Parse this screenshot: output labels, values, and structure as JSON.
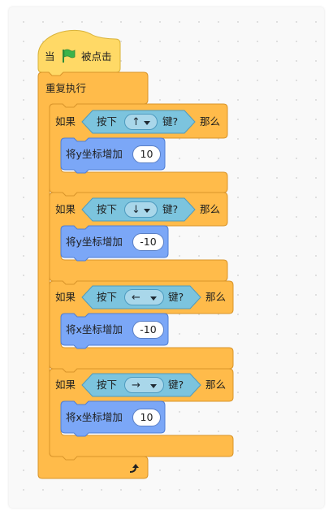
{
  "script": {
    "hat": {
      "prefix": "当",
      "suffix": "被点击",
      "icon": "green-flag-icon"
    },
    "forever": {
      "label": "重复执行",
      "icon": "loop-arrow-icon"
    },
    "if_blocks": [
      {
        "if_label": "如果",
        "then_label": "那么",
        "key_prefix": "按下",
        "key_value": "↑",
        "key_suffix": "键?",
        "action": "将y坐标增加",
        "amount": "10"
      },
      {
        "if_label": "如果",
        "then_label": "那么",
        "key_prefix": "按下",
        "key_value": "↓",
        "key_suffix": "键?",
        "action": "将y坐标增加",
        "amount": "-10"
      },
      {
        "if_label": "如果",
        "then_label": "那么",
        "key_prefix": "按下",
        "key_value": "←",
        "key_suffix": "键?",
        "action": "将x坐标增加",
        "amount": "-10"
      },
      {
        "if_label": "如果",
        "then_label": "那么",
        "key_prefix": "按下",
        "key_value": "→",
        "key_suffix": "键?",
        "action": "将x坐标增加",
        "amount": "10"
      }
    ],
    "colors": {
      "events": "#FFD966",
      "events_border": "#D9B33A",
      "control": "#FFBB4A",
      "control_border": "#D9952B",
      "motion": "#7BA7F7",
      "motion_border": "#4F7FD6",
      "sensing": "#7CC4DE",
      "sensing_border": "#4E9BBF",
      "flag": "#3BB34A"
    }
  }
}
